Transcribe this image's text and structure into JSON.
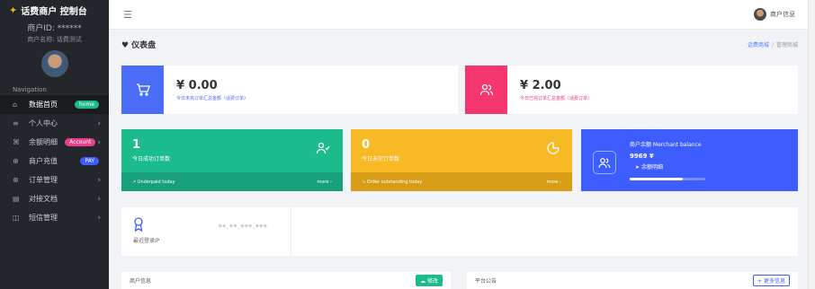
{
  "brand": {
    "title": "话费商户 控制台"
  },
  "merchant": {
    "id_label": "商户ID: ******",
    "name_label": "商户名称: 话费测试"
  },
  "nav_title": "Navigation",
  "nav": [
    {
      "icon": "⌂",
      "label": "数据首页",
      "badge": "home",
      "badge_color": "green",
      "chevron": ""
    },
    {
      "icon": "≡",
      "label": "个人中心",
      "badge": "",
      "badge_color": "",
      "chevron": "›"
    },
    {
      "icon": "⌘",
      "label": "余额明细",
      "badge": "Account",
      "badge_color": "red",
      "chevron": "›"
    },
    {
      "icon": "⊕",
      "label": "商户充值",
      "badge": "PAY",
      "badge_color": "blue",
      "chevron": ""
    },
    {
      "icon": "⊗",
      "label": "订单管理",
      "badge": "",
      "badge_color": "",
      "chevron": "›"
    },
    {
      "icon": "▤",
      "label": "对接文档",
      "badge": "",
      "badge_color": "",
      "chevron": "›"
    },
    {
      "icon": "◫",
      "label": "短信管理",
      "badge": "",
      "badge_color": "",
      "chevron": "›"
    }
  ],
  "topbar": {
    "user_label": "商户信息"
  },
  "page": {
    "title": "仪表盘",
    "crumb_home": "话费商城",
    "crumb_current": "管理商城"
  },
  "stats": [
    {
      "amount": "¥ 0.00",
      "sub": "今日未完订单汇总金额（话费订单）",
      "color": "#4a6cf7",
      "sub_color": "#4a6cf7"
    },
    {
      "amount": "¥ 2.00",
      "sub": "今日已完订单汇总金额（话费订单）",
      "color": "#f5366f",
      "sub_color": "#f5366f"
    }
  ],
  "tiles": [
    {
      "number": "1",
      "label": "今日成功订单数",
      "footer": "Underpaid today",
      "more": "more ›",
      "color": "#1cbb8c",
      "dark": "#17a07a"
    },
    {
      "number": "0",
      "label": "今日未完订单数",
      "footer": "Order outstanding today",
      "more": "more ›",
      "color": "#f7b924",
      "dark": "#d79d16"
    }
  ],
  "balance": {
    "title": "商户余额 Merchant balance",
    "value": "9969 ¥",
    "link": "余额明细",
    "progress": 0.7
  },
  "ip": {
    "label": "最近登录IP",
    "value": "**.**.***.***"
  },
  "bottom": {
    "left_title": "商户信息",
    "edit_label": "修改",
    "right_title": "平台公告",
    "more_label": "+ 更多信息"
  }
}
